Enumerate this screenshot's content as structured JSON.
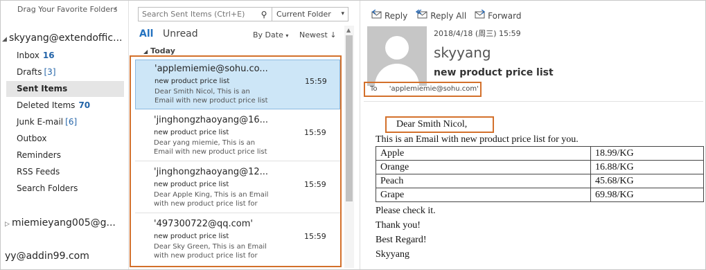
{
  "folder_pane": {
    "favorites_label": "Drag Your Favorite Folders",
    "collapse_glyph": "‹",
    "accounts": [
      {
        "name": "skyyang@extendoffic..."
      },
      {
        "name": "miemieyang005@g..."
      },
      {
        "name": "yy@addin99.com"
      }
    ],
    "folders": [
      {
        "label": "Inbox",
        "count": "16"
      },
      {
        "label": "Drafts",
        "count": "[3]"
      },
      {
        "label": "Sent Items",
        "count": ""
      },
      {
        "label": "Deleted Items",
        "count": "70"
      },
      {
        "label": "Junk E-mail",
        "count": "[6]"
      },
      {
        "label": "Outbox",
        "count": ""
      },
      {
        "label": "Reminders",
        "count": ""
      },
      {
        "label": "RSS Feeds",
        "count": ""
      },
      {
        "label": "Search Folders",
        "count": ""
      }
    ]
  },
  "search": {
    "placeholder": "Search Sent Items (Ctrl+E)",
    "scope": "Current Folder"
  },
  "filters": {
    "all": "All",
    "unread": "Unread",
    "sort_by": "By Date",
    "sort_order": "Newest"
  },
  "group_label": "Today",
  "messages": [
    {
      "to": "'applemiemie@sohu.co...",
      "subject": "new product price list",
      "time": "15:59",
      "preview1": "Dear Smith Nicol,  This is an",
      "preview2": "Email with new product price list"
    },
    {
      "to": "'jinghongzhaoyang@16...",
      "subject": "new product price list",
      "time": "15:59",
      "preview1": "Dear yang miemie,  This is an",
      "preview2": "Email with new product price list"
    },
    {
      "to": "'jinghongzhaoyang@12...",
      "subject": "new product price list",
      "time": "15:59",
      "preview1": "Dear Apple King,  This is an Email",
      "preview2": "with new product price list for"
    },
    {
      "to": "'497300722@qq.com'",
      "subject": "new product price list",
      "time": "15:59",
      "preview1": "Dear Sky Green,  This is an Email",
      "preview2": "with new product price list for"
    }
  ],
  "reading": {
    "actions": {
      "reply": "Reply",
      "reply_all": "Reply All",
      "forward": "Forward"
    },
    "date": "2018/4/18 (周三) 15:59",
    "sender": "skyyang",
    "subject": "new product price list",
    "to_label": "To",
    "to_value": "'applemiemie@sohu.com'",
    "greeting": "Dear Smith Nicol,",
    "intro": "This is an Email with new product price list for you.",
    "prices": [
      {
        "item": "Apple",
        "price": "18.99/KG"
      },
      {
        "item": "Orange",
        "price": "16.88/KG"
      },
      {
        "item": "Peach",
        "price": "45.68/KG"
      },
      {
        "item": "Grape",
        "price": "69.98/KG"
      }
    ],
    "closing": [
      "Please check it.",
      "Thank you!",
      "Best Regard!",
      "Skyyang"
    ]
  },
  "colors": {
    "accent": "#2372c0",
    "highlight": "#d3702b",
    "selected": "#cde6f7"
  }
}
